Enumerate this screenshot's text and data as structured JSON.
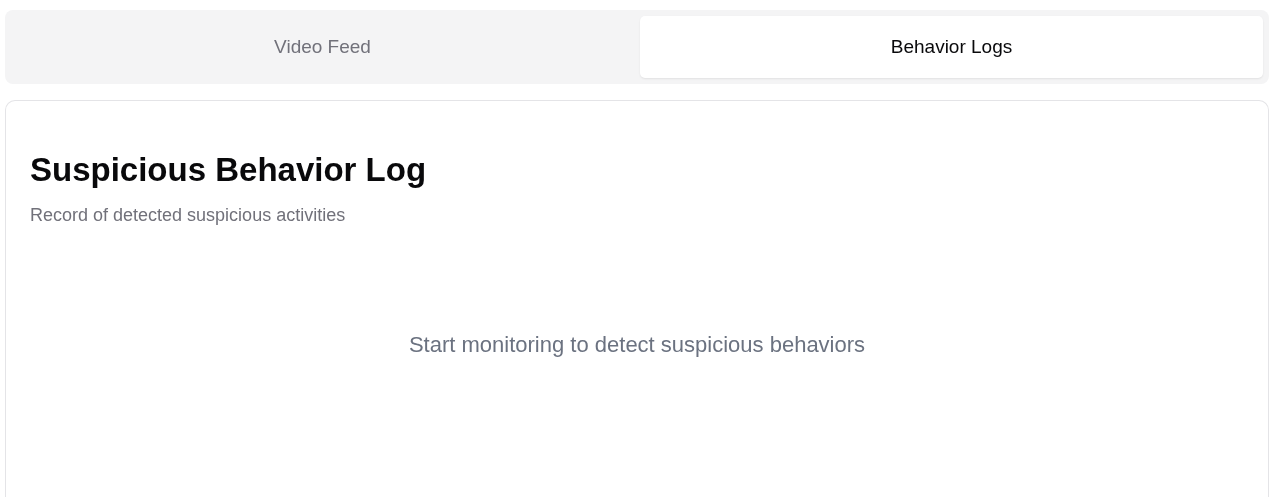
{
  "tabs": [
    {
      "label": "Video Feed",
      "selected": false
    },
    {
      "label": "Behavior Logs",
      "selected": true
    }
  ],
  "panel": {
    "title": "Suspicious Behavior Log",
    "subtitle": "Record of detected suspicious activities",
    "empty_message": "Start monitoring to detect suspicious behaviors"
  }
}
